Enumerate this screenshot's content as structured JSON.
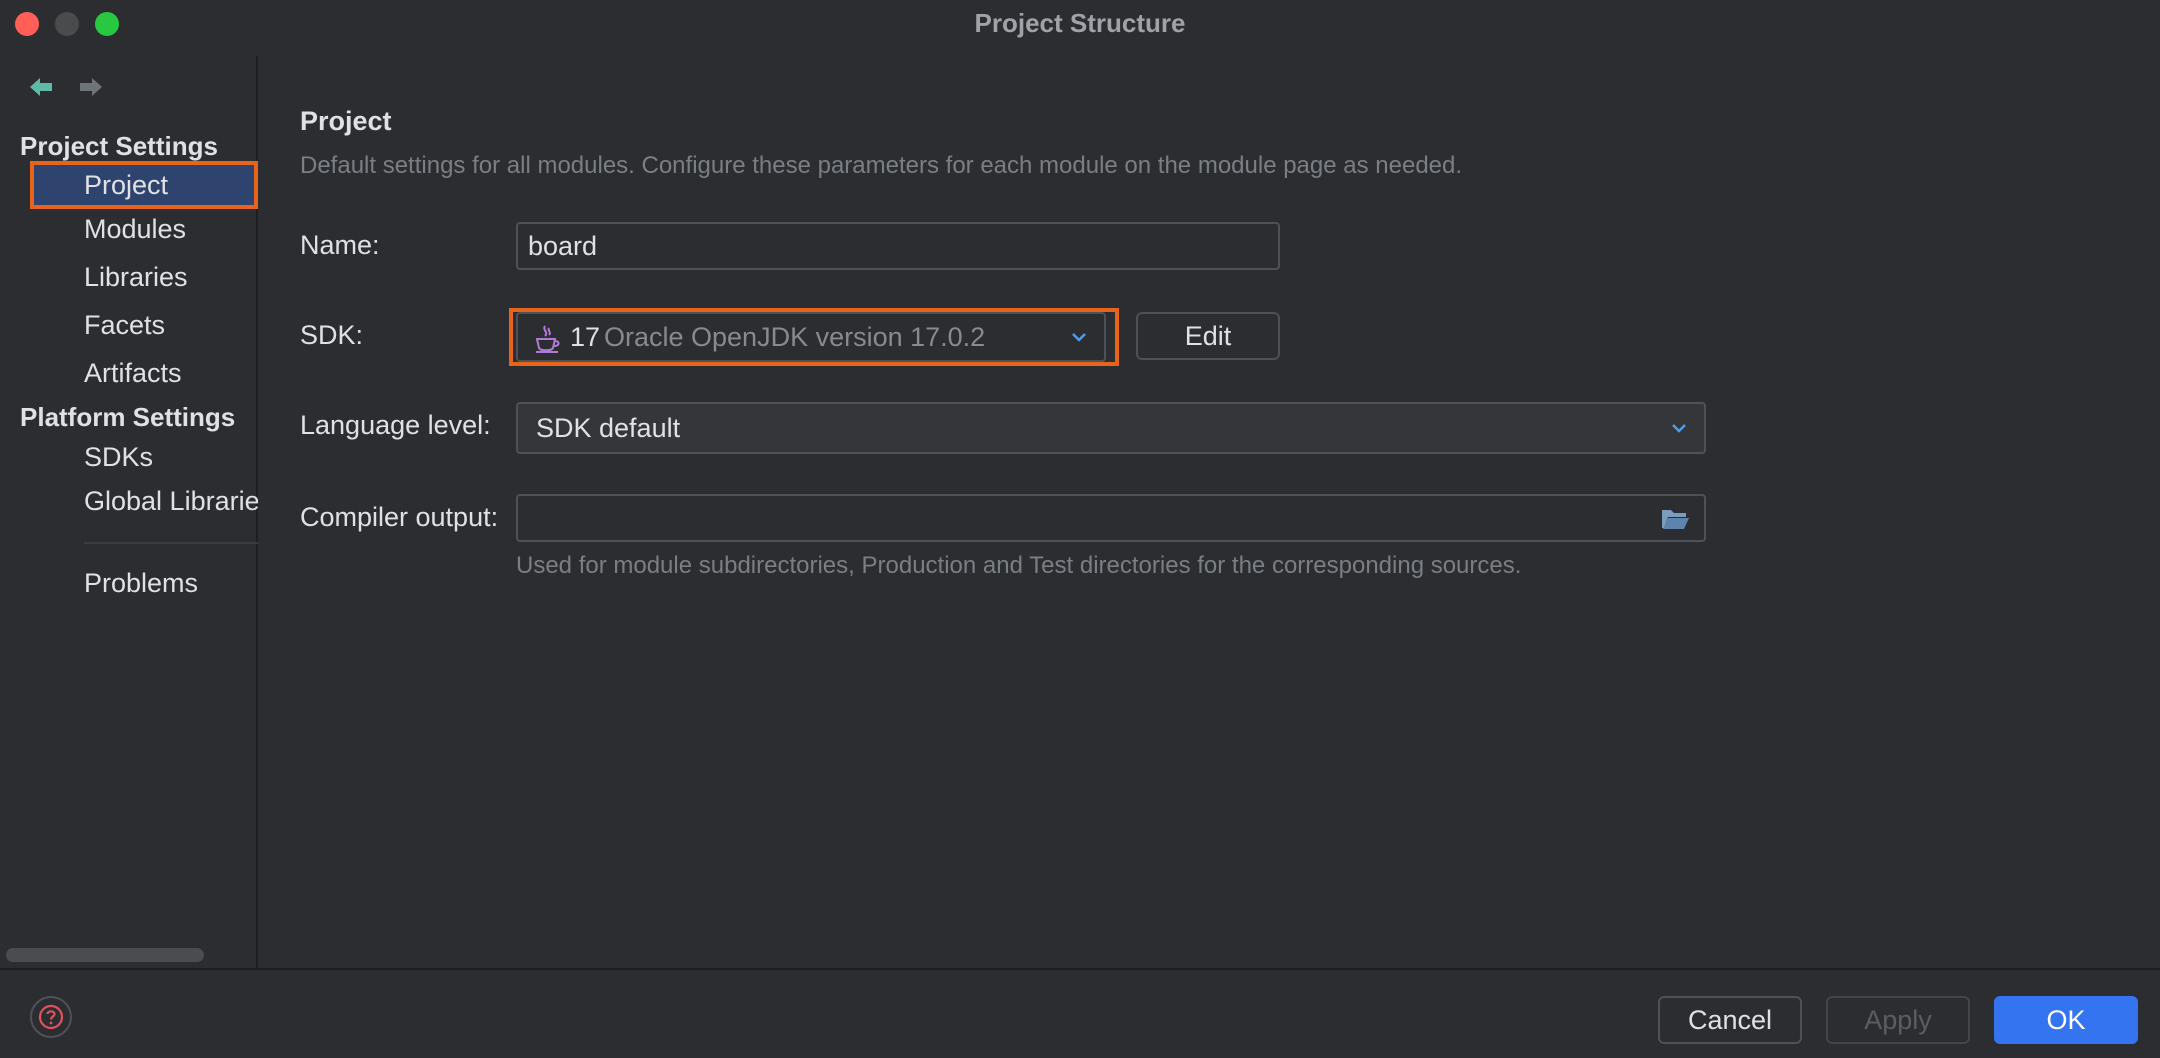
{
  "window": {
    "title": "Project Structure"
  },
  "sidebar": {
    "project_settings_header": "Project Settings",
    "project_items": [
      {
        "label": "Project"
      },
      {
        "label": "Modules"
      },
      {
        "label": "Libraries"
      },
      {
        "label": "Facets"
      },
      {
        "label": "Artifacts"
      }
    ],
    "platform_settings_header": "Platform Settings",
    "platform_items": [
      {
        "label": "SDKs"
      },
      {
        "label": "Global Librarie"
      }
    ],
    "problems_label": "Problems",
    "selected": "Project"
  },
  "main": {
    "title": "Project",
    "description": "Default settings for all modules. Configure these parameters for each module on the module page as needed.",
    "name_label": "Name:",
    "name_value": "board",
    "sdk_label": "SDK:",
    "sdk_version": "17",
    "sdk_name": "Oracle OpenJDK version 17.0.2",
    "edit_label": "Edit",
    "language_level_label": "Language level:",
    "language_level_value": "SDK default",
    "compiler_output_label": "Compiler output:",
    "compiler_output_value": "",
    "compiler_hint": "Used for module subdirectories, Production and Test directories for the corresponding sources."
  },
  "footer": {
    "cancel_label": "Cancel",
    "apply_label": "Apply",
    "ok_label": "OK"
  },
  "colors": {
    "accent": "#3574f0",
    "highlight": "#e8641b",
    "selection": "#2e436e"
  }
}
